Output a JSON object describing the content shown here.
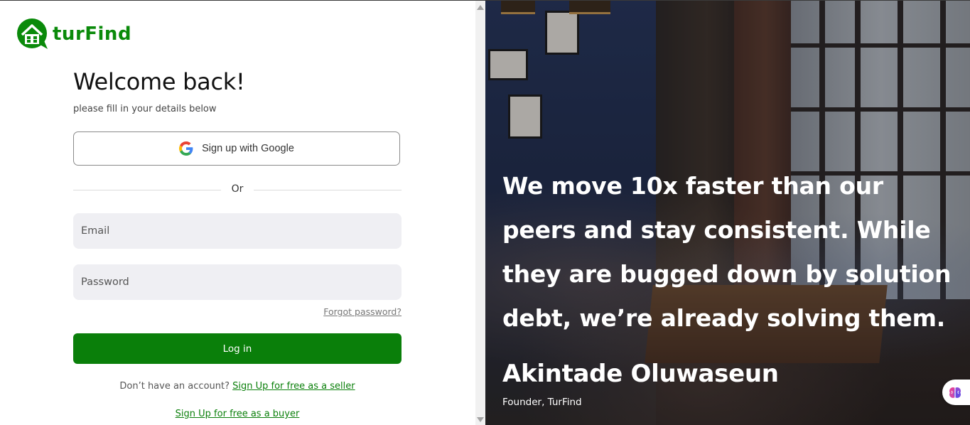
{
  "brand": {
    "name": "turFind",
    "color": "#0a8a0a"
  },
  "login": {
    "title": "Welcome back!",
    "subtitle": "please fill in your details below",
    "google_label": "Sign up with Google",
    "divider": "Or",
    "email_placeholder": "Email",
    "password_placeholder": "Password",
    "forgot": "Forgot password?",
    "login_label": "Log in",
    "no_account": "Don’t have an account?",
    "seller_link": "Sign Up for free as a seller",
    "buyer_link": "Sign Up for free as a buyer",
    "accent": "#0a7f0a"
  },
  "testimonial": {
    "quote": "We move 10x faster than our peers and stay consistent. While they are bugged down by solution debt, we’re already solving them.",
    "author": "Akintade Oluwaseun",
    "role": "Founder, TurFind"
  },
  "icons": {
    "logo": "house-pin-icon",
    "google": "google-icon",
    "extension": "brain-icon"
  }
}
